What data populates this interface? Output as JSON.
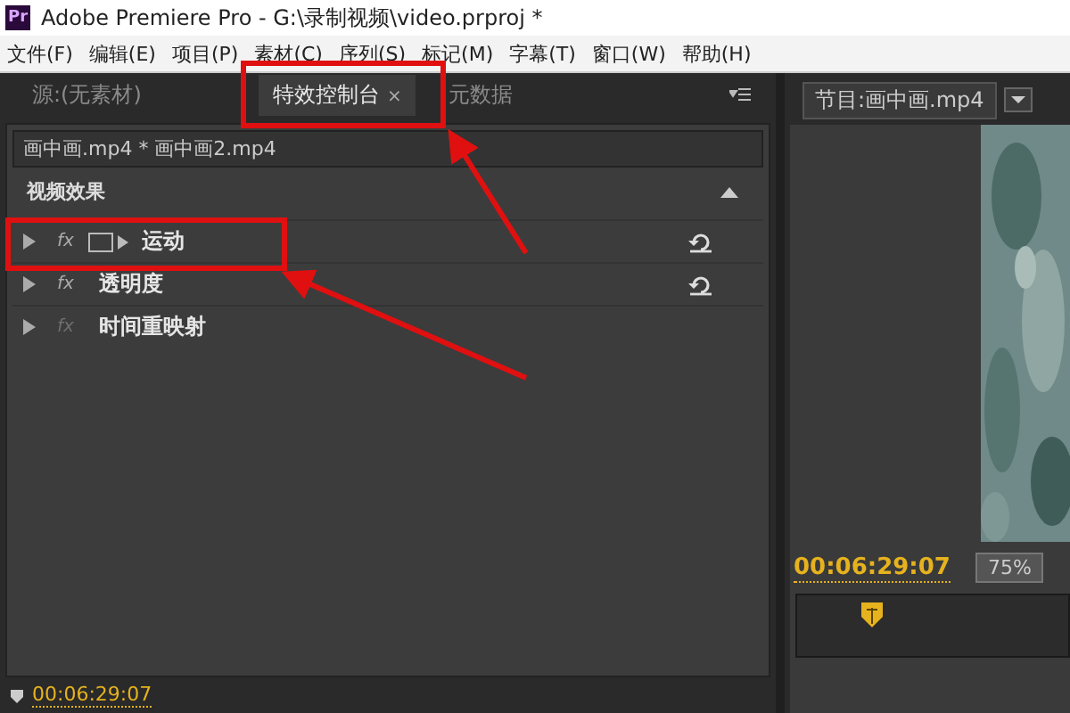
{
  "window": {
    "app_icon": "Pr",
    "title": "Adobe Premiere Pro - G:\\录制视频\\video.prproj *"
  },
  "menu": [
    "文件(F)",
    "编辑(E)",
    "项目(P)",
    "素材(C)",
    "序列(S)",
    "标记(M)",
    "字幕(T)",
    "窗口(W)",
    "帮助(H)"
  ],
  "left_panel": {
    "tabs": [
      {
        "label": "源:(无素材)",
        "selected": false
      },
      {
        "label": "特效控制台",
        "selected": true,
        "close": "×"
      },
      {
        "label": "元数据",
        "selected": false
      }
    ],
    "clip_header": "画中画.mp4 * 画中画2.mp4",
    "section": "视频效果",
    "effects": [
      {
        "name": "运动",
        "fx": "fx",
        "fx_active": true,
        "motion_icon": true,
        "resettable": true
      },
      {
        "name": "透明度",
        "fx": "fx",
        "fx_active": true,
        "motion_icon": false,
        "resettable": true
      },
      {
        "name": "时间重映射",
        "fx": "fx",
        "fx_active": false,
        "motion_icon": false,
        "resettable": false
      }
    ],
    "timecode": "00:06:29:07"
  },
  "right_panel": {
    "tab": "节目:画中画.mp4",
    "timecode": "00:06:29:07",
    "zoom": "75%"
  },
  "annotations": [
    {
      "kind": "box"
    },
    {
      "kind": "box"
    },
    {
      "kind": "arrow"
    },
    {
      "kind": "arrow"
    }
  ]
}
